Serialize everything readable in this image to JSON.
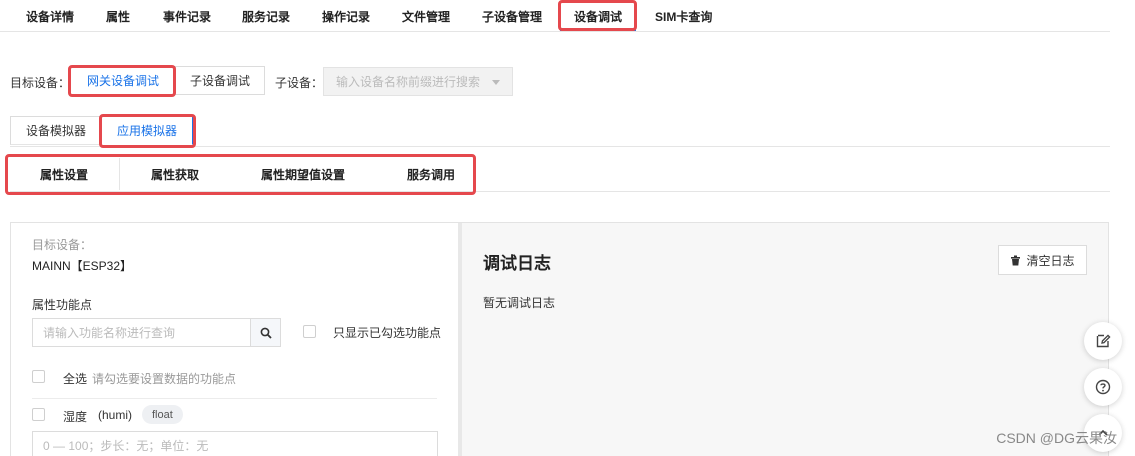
{
  "top_tabs": [
    {
      "label": "设备详情"
    },
    {
      "label": "属性"
    },
    {
      "label": "事件记录"
    },
    {
      "label": "服务记录"
    },
    {
      "label": "操作记录"
    },
    {
      "label": "文件管理"
    },
    {
      "label": "子设备管理"
    },
    {
      "label": "设备调试",
      "active": true
    },
    {
      "label": "SIM卡查询"
    }
  ],
  "target": {
    "label": "目标设备：",
    "gateway_btn": "网关设备调试",
    "sub_btn": "子设备调试",
    "subdevice_label": "子设备：",
    "subdevice_placeholder": "输入设备名称前缀进行搜索"
  },
  "simulator_tabs": {
    "device": "设备模拟器",
    "app": "应用模拟器"
  },
  "function_tabs": [
    "属性设置",
    "属性获取",
    "属性期望值设置",
    "服务调用"
  ],
  "left": {
    "target_label": "目标设备：",
    "target_value": "MAINN【ESP32】",
    "func_label": "属性功能点",
    "search_placeholder": "请输入功能名称进行查询",
    "only_checked": "只显示已勾选功能点",
    "select_all": "全选",
    "select_hint": "请勾选要设置数据的功能点",
    "property_name": "湿度",
    "property_id": "(humi)",
    "property_type": "float",
    "value_placeholder": "0 — 100；步长：无；单位：无"
  },
  "right": {
    "title": "调试日志",
    "clear_label": "清空日志",
    "empty_text": "暂无调试日志"
  },
  "watermark": "CSDN @DG云果汝"
}
